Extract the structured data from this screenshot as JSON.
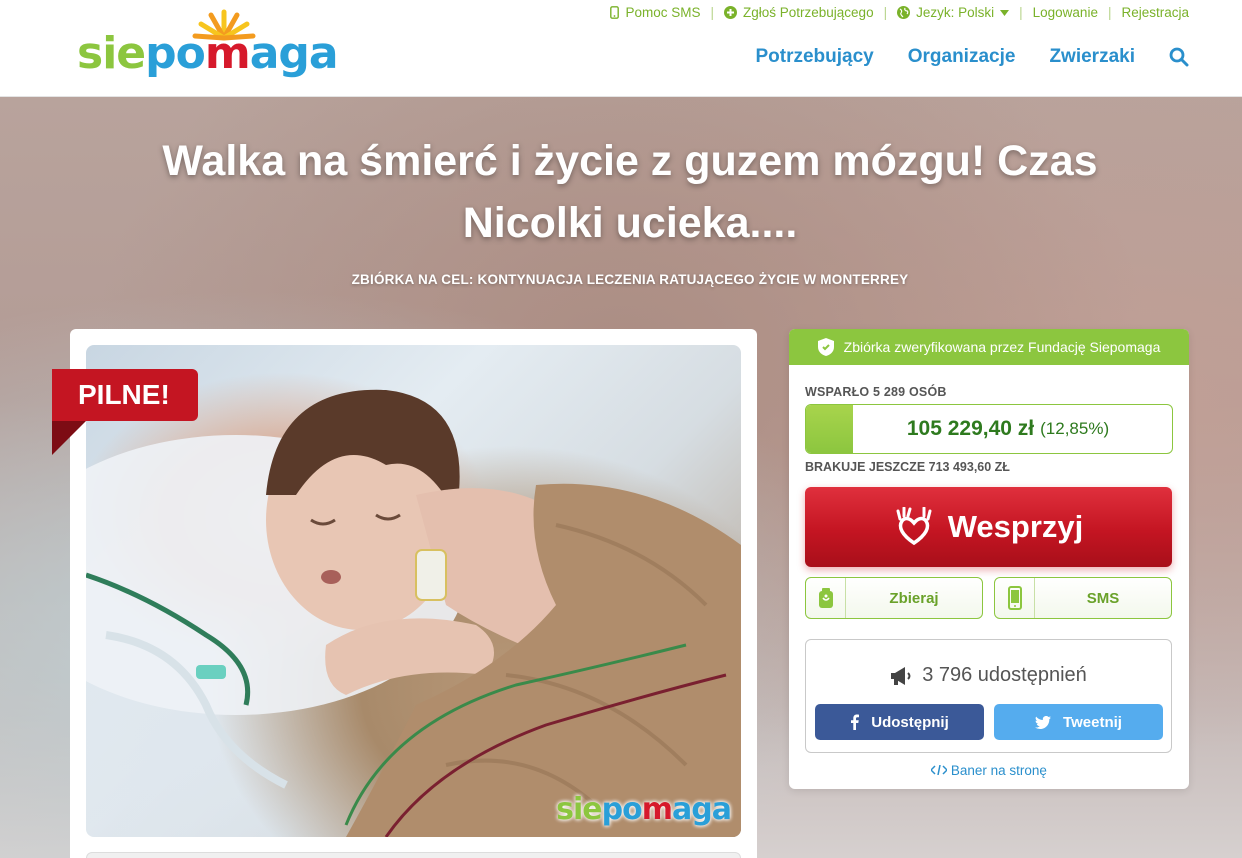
{
  "header": {
    "logo": {
      "sie": "sie",
      "po": "po",
      "heart": "m",
      "aga": "aga"
    },
    "toplinks": {
      "sms": "Pomoc SMS",
      "report": "Zgłoś Potrzebującego",
      "language": "Jezyk: Polski",
      "login": "Logowanie",
      "register": "Rejestracja"
    },
    "nav": [
      "Potrzebujący",
      "Organizacje",
      "Zwierzaki"
    ]
  },
  "hero": {
    "title": "Walka na śmierć i życie z guzem mózgu! Czas Nicolki ucieka....",
    "subtitle": "ZBIÓRKA NA CEL: KONTYNUACJA LECZENIA RATUJĄCEGO ŻYCIE W MONTERREY",
    "urgent_label": "PILNE!",
    "photo_logo": {
      "sie": "sie",
      "po": "po",
      "heart": "m",
      "aga": "aga"
    }
  },
  "campaign": {
    "verified_text": "Zbiórka zweryfikowana przez Fundację Siepomaga",
    "supporters": "WSPARŁO 5 289 OSÓB",
    "amount": "105 229,40 zł",
    "percent_text": "(12,85%)",
    "progress_fraction": 0.1285,
    "missing": "BRAKUJE JESZCZE 713 493,60 ZŁ",
    "support_label": "Wesprzyj",
    "collect_label": "Zbieraj",
    "sms_label": "SMS",
    "shares": "3 796 udostępnień",
    "facebook_label": "Udostępnij",
    "twitter_label": "Tweetnij",
    "banner_label": "Baner na stronę"
  },
  "colors": {
    "green": "#8cc63f",
    "blue": "#2a8fcc",
    "red": "#c41522",
    "facebook": "#3b5998",
    "twitter": "#55acee"
  }
}
